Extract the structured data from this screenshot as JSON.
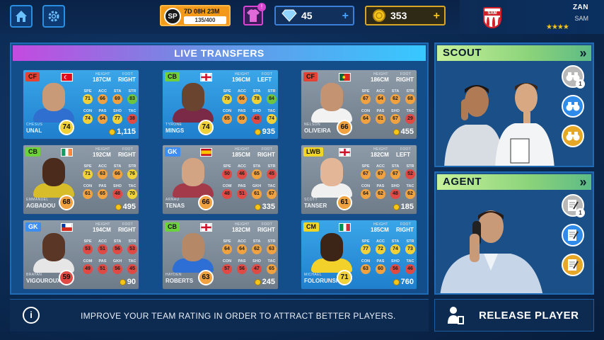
{
  "topbar": {
    "sp_badge": "SP",
    "sp_timer": "7D 08H 23M",
    "sp_progress_text": "135/400",
    "kit_notification": "!",
    "diamonds": "45",
    "coins": "353",
    "plus": "+",
    "profile_name": "ZAN",
    "profile_club": "SAM",
    "crest_label": "SAM",
    "stars": "★★★★",
    "star_rating": 3.5
  },
  "live_transfers": {
    "title": "LIVE TRANSFERS",
    "stat_labels": [
      "SPE",
      "ACC",
      "STA",
      "STR",
      "CON",
      "PAS",
      "SHO",
      "TAC"
    ],
    "gk_stat_labels": [
      "SPE",
      "ACC",
      "STA",
      "STR",
      "COM",
      "PAS",
      "GKH",
      "TAC"
    ],
    "height_label": "HEIGHT",
    "foot_label": "FOOT",
    "players": [
      {
        "pos": "CF",
        "pos_class": "cf",
        "card": "blue",
        "flag": "turkey",
        "first": "CHESUS",
        "last": "UNAL",
        "height": "187CM",
        "foot": "RIGHT",
        "rating": "74",
        "stats": [
          "71",
          "66",
          "69",
          "83",
          "74",
          "64",
          "77",
          "38"
        ],
        "price": "1,115",
        "skin": "#c99a77",
        "shirt": "#2f6fd0",
        "gk": false
      },
      {
        "pos": "CB",
        "pos_class": "cb",
        "card": "blue",
        "flag": "england",
        "first": "TYRONE",
        "last": "MINGS",
        "height": "196CM",
        "foot": "LEFT",
        "rating": "74",
        "stats": [
          "79",
          "66",
          "78",
          "84",
          "65",
          "69",
          "48",
          "74"
        ],
        "price": "935",
        "skin": "#6b4430",
        "shirt": "#7a2a47",
        "gk": false
      },
      {
        "pos": "CF",
        "pos_class": "cf",
        "card": "grey",
        "flag": "portugal",
        "first": "NELSON",
        "last": "OLIVEIRA",
        "height": "186CM",
        "foot": "RIGHT",
        "rating": "66",
        "stats": [
          "67",
          "64",
          "62",
          "68",
          "64",
          "61",
          "67",
          "29"
        ],
        "price": "455",
        "skin": "#c49372",
        "shirt": "#f2f2f2",
        "gk": false
      },
      {
        "pos": "CB",
        "pos_class": "cb",
        "card": "grey",
        "flag": "ireland",
        "first": "EMMANUEL",
        "last": "AGBADOU",
        "height": "192CM",
        "foot": "RIGHT",
        "rating": "68",
        "stats": [
          "71",
          "63",
          "66",
          "76",
          "61",
          "65",
          "48",
          "70"
        ],
        "price": "495",
        "skin": "#4a2b1c",
        "shirt": "#d8bd2a",
        "gk": false
      },
      {
        "pos": "GK",
        "pos_class": "gk",
        "card": "grey",
        "flag": "spain",
        "first": "ARNAU",
        "last": "TENAS",
        "height": "185CM",
        "foot": "RIGHT",
        "rating": "66",
        "stats": [
          "50",
          "46",
          "65",
          "45",
          "48",
          "51",
          "61",
          "67"
        ],
        "price": "335",
        "skin": "#d2a484",
        "shirt": "#a23a4a",
        "gk": true
      },
      {
        "pos": "LWB",
        "pos_class": "lwb",
        "card": "grey",
        "flag": "england",
        "first": "SCOTT",
        "last": "TANSER",
        "height": "182CM",
        "foot": "LEFT",
        "rating": "61",
        "stats": [
          "67",
          "67",
          "67",
          "52",
          "64",
          "62",
          "48",
          "62"
        ],
        "price": "185",
        "skin": "#e2b696",
        "shirt": "#f0f0f0",
        "gk": false
      },
      {
        "pos": "GK",
        "pos_class": "gk",
        "card": "grey",
        "flag": "chile",
        "first": "BRAYAN",
        "last": "VIGOUROUX",
        "height": "194CM",
        "foot": "RIGHT",
        "rating": "59",
        "stats": [
          "53",
          "51",
          "56",
          "53",
          "49",
          "51",
          "56",
          "45"
        ],
        "price": "90",
        "skin": "#5a3626",
        "shirt": "#e6e6e6",
        "gk": true
      },
      {
        "pos": "CB",
        "pos_class": "cb",
        "card": "grey",
        "flag": "england",
        "first": "HAYDEN",
        "last": "ROBERTS",
        "height": "182CM",
        "foot": "RIGHT",
        "rating": "63",
        "stats": [
          "64",
          "64",
          "62",
          "63",
          "57",
          "56",
          "47",
          "65"
        ],
        "price": "245",
        "skin": "#b58968",
        "shirt": "#2e6fd6",
        "gk": false
      },
      {
        "pos": "CM",
        "pos_class": "cm",
        "card": "blue",
        "flag": "italy",
        "first": "MICHAEL",
        "last": "FOLORUNSHO",
        "height": "185CM",
        "foot": "RIGHT",
        "rating": "71",
        "stats": [
          "77",
          "72",
          "74",
          "73",
          "63",
          "60",
          "56",
          "46"
        ],
        "price": "760",
        "skin": "#3c2416",
        "shirt": "#f2d12a",
        "gk": false
      }
    ]
  },
  "scout": {
    "title": "SCOUT",
    "chevron": "»",
    "buttons": [
      {
        "icon": "binoculars-icon",
        "color": "#b8b8b8",
        "count": "1"
      },
      {
        "icon": "binoculars-icon",
        "color": "#2f8bea",
        "count": ""
      },
      {
        "icon": "binoculars-icon",
        "color": "#e6a727",
        "count": ""
      }
    ]
  },
  "agent": {
    "title": "AGENT",
    "chevron": "»",
    "buttons": [
      {
        "icon": "contract-icon",
        "color": "#b8b8b8",
        "count": "1"
      },
      {
        "icon": "contract-icon",
        "color": "#2f8bea",
        "count": ""
      },
      {
        "icon": "contract-icon",
        "color": "#e6a727",
        "count": ""
      }
    ]
  },
  "footer": {
    "tip_icon": "i",
    "tip": "IMPROVE YOUR TEAM RATING IN ORDER TO ATTRACT BETTER PLAYERS.",
    "release_label": "RELEASE PLAYER"
  },
  "colors": {
    "stat_green": "#6fc43f",
    "stat_orange": "#f0a240",
    "stat_red": "#e04a45",
    "stat_yellow": "#f1d13a",
    "card_blue": "#3aa6e8",
    "card_grey": "#7c8896"
  }
}
